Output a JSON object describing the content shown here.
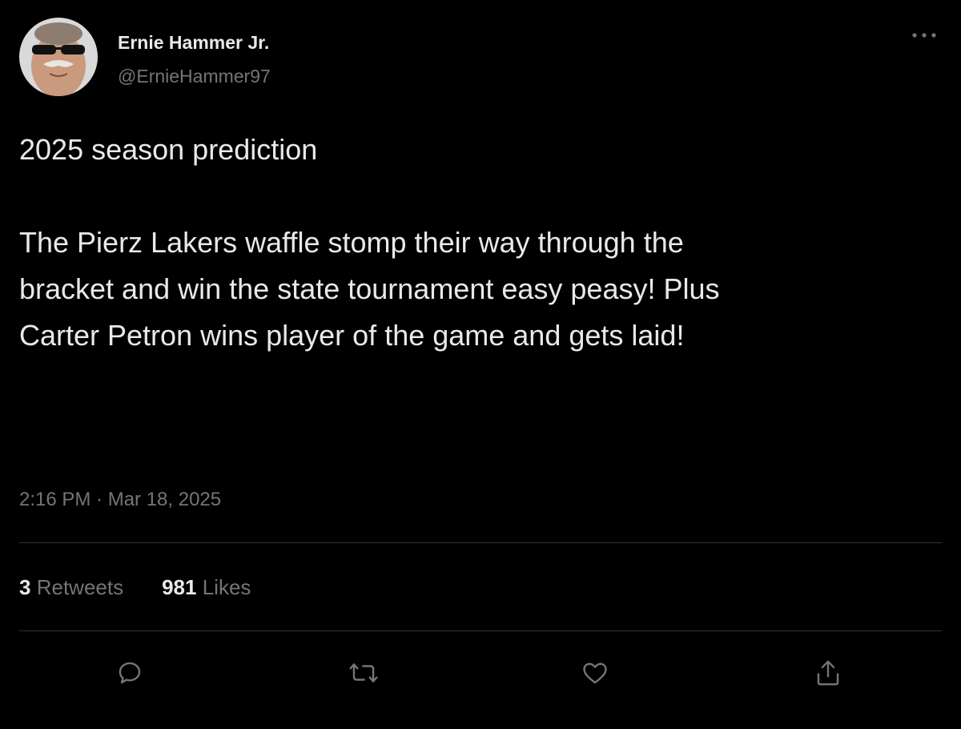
{
  "user": {
    "display_name": "Ernie Hammer Jr.",
    "handle": "@ErnieHammer97",
    "avatar_icon": "profile-photo"
  },
  "tweet": {
    "line1": "2025 season prediction",
    "line2": "The Pierz Lakers waffle stomp their way through the\nbracket and win the state tournament easy peasy! Plus\nCarter Petron wins player of the game and gets laid!",
    "timestamp": "2:16 PM · Mar 18, 2025"
  },
  "stats": {
    "retweets_count": "3",
    "retweets_label": "Retweets",
    "likes_count": "981",
    "likes_label": "Likes"
  },
  "actions": [
    {
      "icon": "reply-icon"
    },
    {
      "icon": "retweet-icon"
    },
    {
      "icon": "like-icon"
    },
    {
      "icon": "share-icon"
    }
  ],
  "colors": {
    "background": "#000000",
    "primary_text": "#e7e9ea",
    "secondary_text": "#71767b",
    "divider": "#2f3336"
  }
}
